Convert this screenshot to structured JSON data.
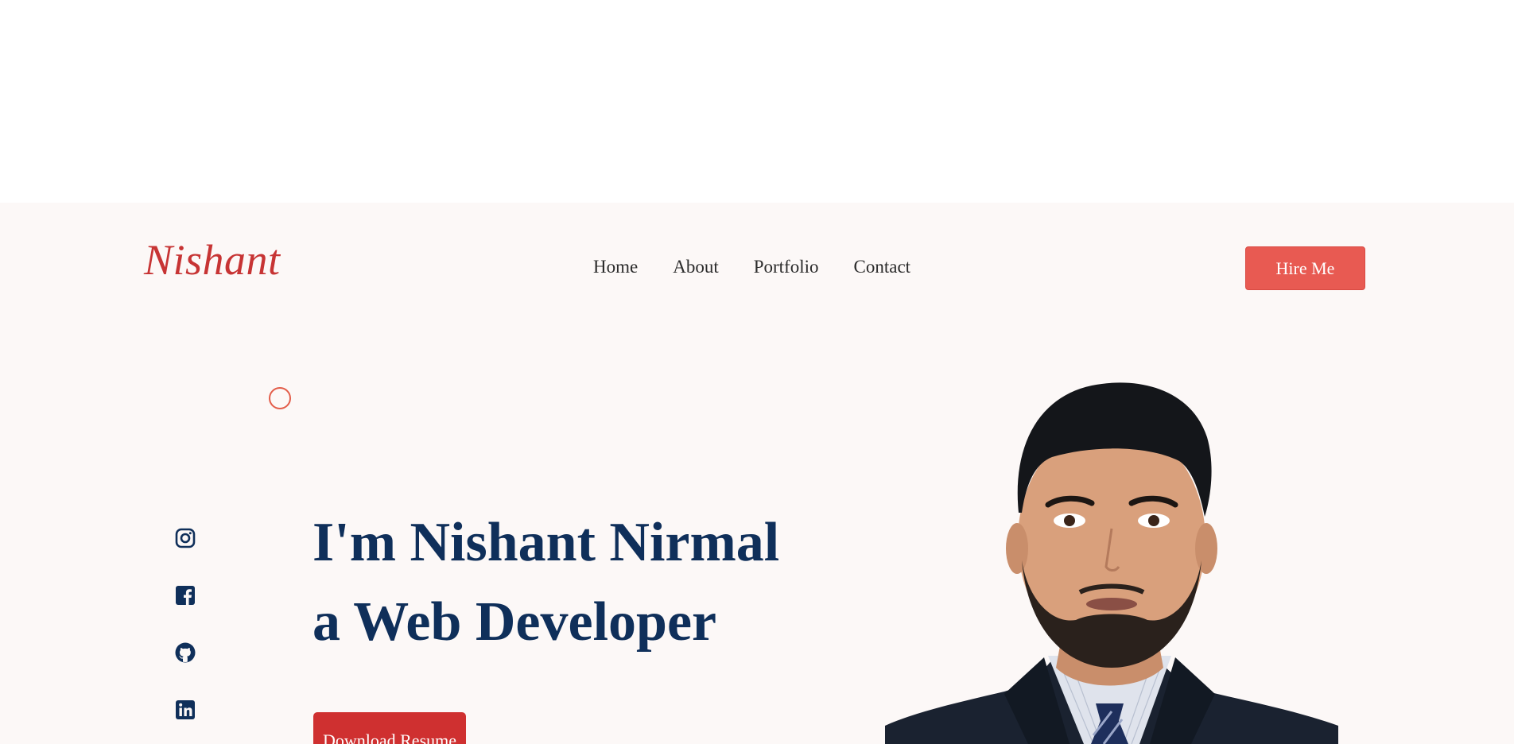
{
  "brand": {
    "name": "Nishant"
  },
  "nav": {
    "items": [
      {
        "label": "Home"
      },
      {
        "label": "About"
      },
      {
        "label": "Portfolio"
      },
      {
        "label": "Contact"
      }
    ]
  },
  "header": {
    "cta_label": "Hire Me"
  },
  "hero": {
    "line1": "I'm Nishant Nirmal",
    "line2": "a Web Developer",
    "download_label": "Download Resume"
  },
  "socials": [
    {
      "icon": "instagram-icon"
    },
    {
      "icon": "facebook-icon"
    },
    {
      "icon": "github-icon"
    },
    {
      "icon": "linkedin-icon"
    }
  ],
  "colors": {
    "brand_red": "#c73434",
    "cta_red": "#e85a52",
    "download_red": "#cf3030",
    "heading_navy": "#0f2f5a",
    "page_bg": "#fcf8f7"
  }
}
